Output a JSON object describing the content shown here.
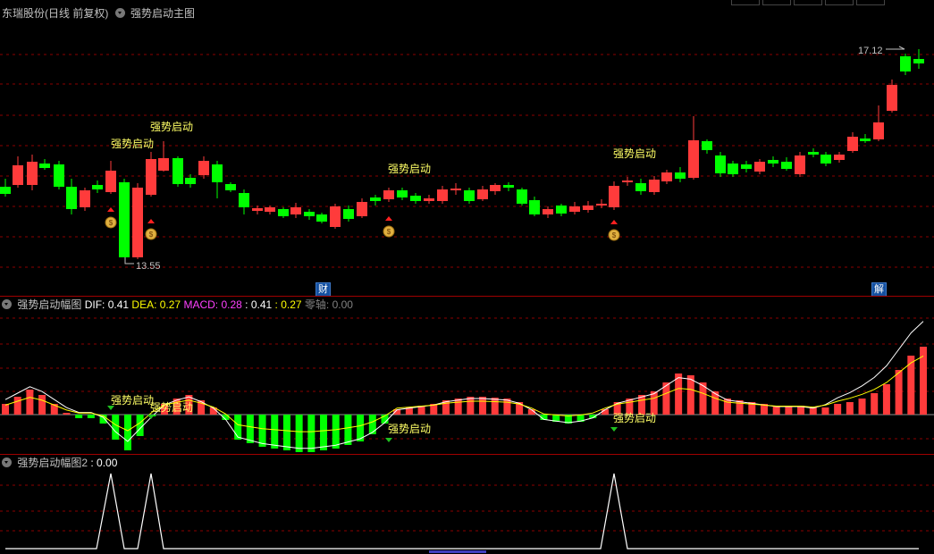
{
  "main": {
    "stock_name": "东瑞股份(日线 前复权)",
    "indicator_name": "强势启动主图",
    "high_label": "17.12",
    "low_label": "13.55",
    "signal_label": "强势启动",
    "badge_cai": "财",
    "badge_jie": "解"
  },
  "macd": {
    "name": "强势启动幅图",
    "dif_label": "DIF: 0.41",
    "dea_label": "DEA: 0.27",
    "macd_label": "MACD: 0.28",
    "v4_label": ": 0.41",
    "v5_label": ": 0.27",
    "zero_label": "零轴: 0.00"
  },
  "sub2": {
    "name": "强势启动幅图2",
    "value_label": ": 0.00"
  },
  "colors": {
    "up": "#ff3b3b",
    "down": "#00ff00",
    "grid": "#8b0000",
    "dif": "#ffffff",
    "dea": "#ffff00",
    "signal_text": "#ffff66"
  }
}
